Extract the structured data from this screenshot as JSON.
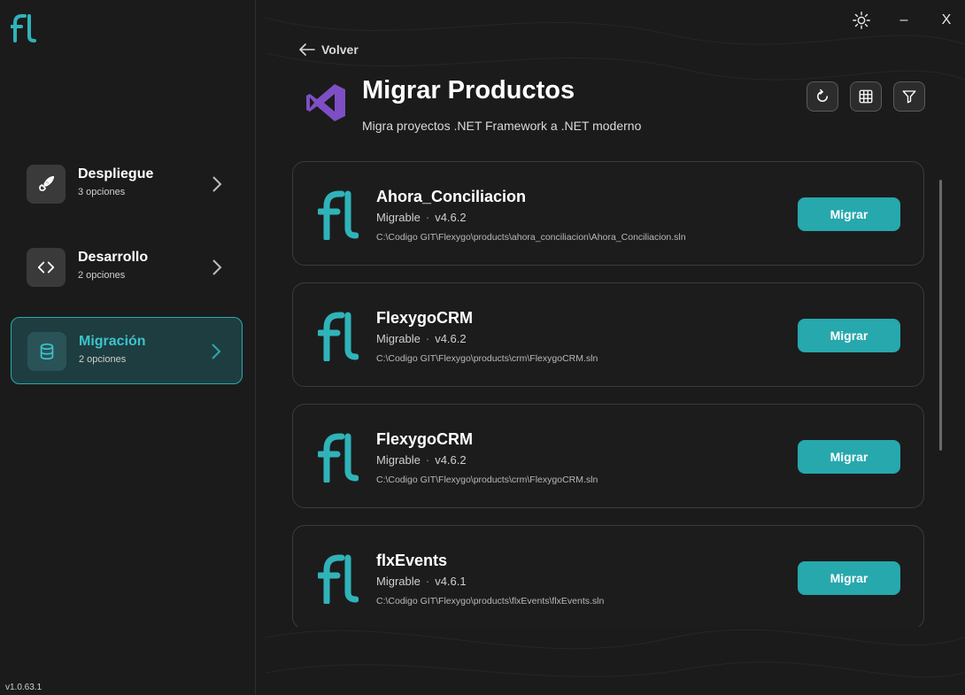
{
  "app": {
    "version": "v1.0.63.1",
    "accent": "#26a8ad"
  },
  "window_controls": {
    "theme_icon": "sun-icon",
    "minimize_label": "–",
    "close_label": "X"
  },
  "sidebar": {
    "items": [
      {
        "title": "Despliegue",
        "subtitle": "3 opciones",
        "icon": "rocket-icon",
        "active": false
      },
      {
        "title": "Desarrollo",
        "subtitle": "2 opciones",
        "icon": "code-icon",
        "active": false
      },
      {
        "title": "Migración",
        "subtitle": "2 opciones",
        "icon": "database-icon",
        "active": true
      }
    ]
  },
  "header": {
    "back_label": "Volver",
    "title": "Migrar Productos",
    "subtitle": "Migra proyectos .NET Framework a .NET moderno",
    "tools": [
      "refresh-icon",
      "grid-icon",
      "filter-icon"
    ]
  },
  "products": [
    {
      "name": "Ahora_Conciliacion",
      "status": "Migrable",
      "version": "v4.6.2",
      "path": "C:\\Codigo GIT\\Flexygo\\products\\ahora_conciliacion\\Ahora_Conciliacion.sln",
      "action": "Migrar"
    },
    {
      "name": "FlexygoCRM",
      "status": "Migrable",
      "version": "v4.6.2",
      "path": "C:\\Codigo GIT\\Flexygo\\products\\crm\\FlexygoCRM.sln",
      "action": "Migrar"
    },
    {
      "name": "FlexygoCRM",
      "status": "Migrable",
      "version": "v4.6.2",
      "path": "C:\\Codigo GIT\\Flexygo\\products\\crm\\FlexygoCRM.sln",
      "action": "Migrar"
    },
    {
      "name": "flxEvents",
      "status": "Migrable",
      "version": "v4.6.1",
      "path": "C:\\Codigo GIT\\Flexygo\\products\\flxEvents\\flxEvents.sln",
      "action": "Migrar"
    }
  ]
}
